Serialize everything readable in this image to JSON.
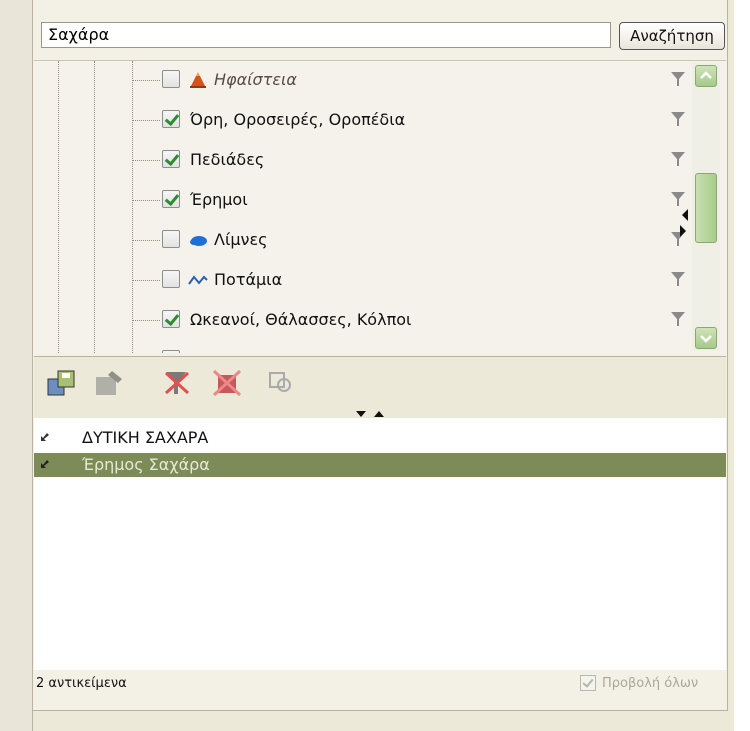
{
  "search": {
    "value": "Σαχάρα",
    "button_label": "Αναζήτηση"
  },
  "tree": {
    "items": [
      {
        "label": "Ηφαίστεια",
        "checked": false,
        "icon": "volcano-icon",
        "italic": true
      },
      {
        "label": "Όρη, Οροσειρές, Οροπέδια",
        "checked": true,
        "icon": null
      },
      {
        "label": "Πεδιάδες",
        "checked": true,
        "icon": null
      },
      {
        "label": "Έρημοι",
        "checked": true,
        "icon": null
      },
      {
        "label": "Λίμνες",
        "checked": false,
        "icon": "lake-icon"
      },
      {
        "label": "Ποτάμια",
        "checked": false,
        "icon": "river-icon"
      },
      {
        "label": "Ωκεανοί, Θάλασσες, Κόλποι",
        "checked": true,
        "icon": null
      }
    ]
  },
  "results": [
    {
      "label": "ΔΥΤΙΚΗ ΣΑΧΑΡΑ",
      "selected": false
    },
    {
      "label": "Έρημος Σαχάρα",
      "selected": true
    }
  ],
  "status": {
    "count_text": "2 αντικείμενα",
    "show_all_label": "Προβολή όλων",
    "show_all_checked": true,
    "show_all_enabled": false
  },
  "colors": {
    "accent_green": "#7c8b57",
    "filter_gray": "#8a8a8a",
    "volcano_orange": "#d4531c",
    "lake_blue": "#1f6fd6",
    "river_blue": "#2a5fb5"
  }
}
